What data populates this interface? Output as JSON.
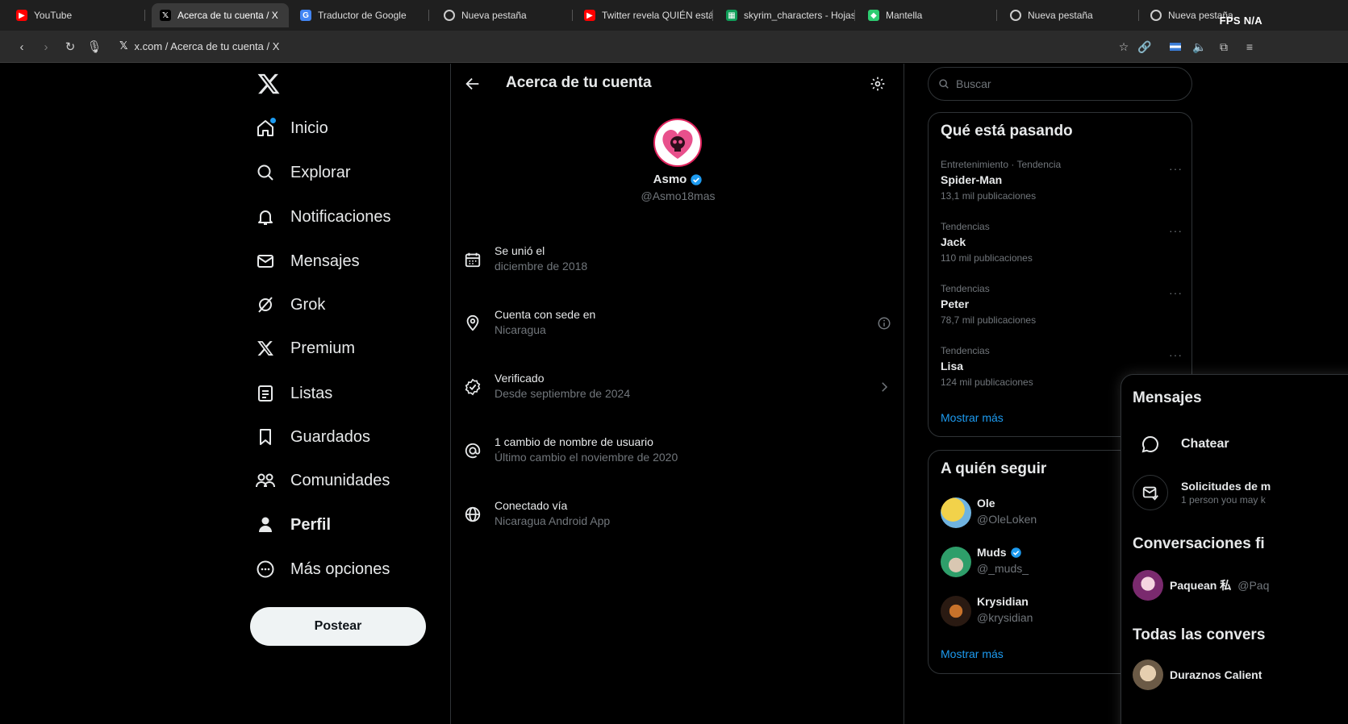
{
  "browser": {
    "tabs": [
      {
        "title": "YouTube",
        "icon": "youtube-icon",
        "color": "#ff0000"
      },
      {
        "title": "Acerca de tu cuenta / X",
        "icon": "x-icon",
        "color": "#000000",
        "active": true
      },
      {
        "title": "Traductor de Google",
        "icon": "google-translate-icon",
        "color": "#4285f4"
      },
      {
        "title": "Nueva pestaña",
        "icon": "opera-gx-icon",
        "color": "#cccccc"
      },
      {
        "title": "Twitter revela QUIÉN está",
        "icon": "youtube-icon",
        "color": "#ff0000"
      },
      {
        "title": "skyrim_characters - Hojas",
        "icon": "sheets-icon",
        "color": "#0f9d58"
      },
      {
        "title": "Mantella",
        "icon": "mantella-icon",
        "color": "#2ecc71"
      },
      {
        "title": "Nueva pestaña",
        "icon": "opera-gx-icon",
        "color": "#cccccc"
      },
      {
        "title": "Nueva pestaña",
        "icon": "opera-gx-icon",
        "color": "#cccccc"
      }
    ],
    "fps_label": "FPS N/A",
    "url": "x.com / Acerca de tu cuenta / X"
  },
  "nav": {
    "items": [
      {
        "label": "Inicio",
        "icon": "home-icon"
      },
      {
        "label": "Explorar",
        "icon": "search-icon"
      },
      {
        "label": "Notificaciones",
        "icon": "bell-icon"
      },
      {
        "label": "Mensajes",
        "icon": "mail-icon"
      },
      {
        "label": "Grok",
        "icon": "grok-icon"
      },
      {
        "label": "Premium",
        "icon": "x-logo-icon"
      },
      {
        "label": "Listas",
        "icon": "list-icon"
      },
      {
        "label": "Guardados",
        "icon": "bookmark-icon"
      },
      {
        "label": "Comunidades",
        "icon": "communities-icon"
      },
      {
        "label": "Perfil",
        "icon": "profile-icon"
      },
      {
        "label": "Más opciones",
        "icon": "more-icon"
      }
    ],
    "post_label": "Postear"
  },
  "main": {
    "title": "Acerca de tu cuenta",
    "profile": {
      "name": "Asmo",
      "handle": "@Asmo18mas"
    },
    "info": [
      {
        "title": "Se unió el",
        "sub": "diciembre de 2018",
        "icon": "calendar-icon"
      },
      {
        "title": "Cuenta con sede en",
        "sub": "Nicaragua",
        "icon": "location-icon"
      },
      {
        "title": "Verificado",
        "sub": "Desde septiembre de 2024",
        "icon": "verified-outline-icon"
      },
      {
        "title": "1 cambio de nombre de usuario",
        "sub": "Último cambio el noviembre de 2020",
        "icon": "at-icon"
      },
      {
        "title": "Conectado vía",
        "sub": "Nicaragua Android App",
        "icon": "globe-icon"
      }
    ]
  },
  "right": {
    "search_placeholder": "Buscar",
    "trends_title": "Qué está pasando",
    "trends": [
      {
        "category": "Entretenimiento · Tendencia",
        "name": "Spider-Man",
        "count": "13,1 mil publicaciones"
      },
      {
        "category": "Tendencias",
        "name": "Jack",
        "count": "110 mil publicaciones"
      },
      {
        "category": "Tendencias",
        "name": "Peter",
        "count": "78,7 mil publicaciones"
      },
      {
        "category": "Tendencias",
        "name": "Lisa",
        "count": "124 mil publicaciones"
      }
    ],
    "trends_more": "Mostrar más",
    "follow_title": "A quién seguir",
    "follow": [
      {
        "name": "Ole",
        "handle": "@OleLoken",
        "verified": false
      },
      {
        "name": "Muds",
        "handle": "@_muds_",
        "verified": true
      },
      {
        "name": "Krysidian",
        "handle": "@krysidian",
        "verified": false
      }
    ],
    "follow_more": "Mostrar más"
  },
  "messages": {
    "title": "Mensajes",
    "chat_label": "Chatear",
    "requests_label": "Solicitudes de m",
    "requests_sub": "1 person you may k",
    "pinned_title": "Conversaciones fi",
    "pinned_name": "Paquean 私",
    "pinned_handle": "@Paq",
    "all_title": "Todas las convers",
    "all_first": "Duraznos Calient"
  },
  "colors": {
    "accent": "#1d9bf0",
    "bg": "#000000",
    "border": "#2f3336",
    "muted": "#71767b"
  }
}
